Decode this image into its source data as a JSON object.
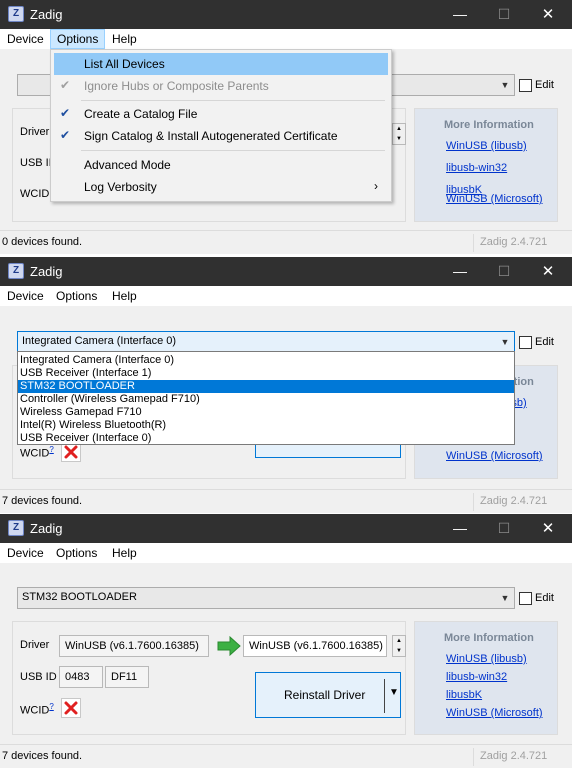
{
  "app": {
    "title": "Zadig",
    "icon": "zadig-app-icon",
    "icon_glyph": "Z",
    "window_buttons": {
      "minimize": "—",
      "maximize": "☐",
      "close": "✕"
    },
    "version": "Zadig 2.4.721"
  },
  "menubar": {
    "device": "Device",
    "options": "Options",
    "help": "Help"
  },
  "labels": {
    "edit": "Edit",
    "driver": "Driver",
    "usb_id": "USB ID",
    "wcid": "WCID",
    "wcid_sup": "?"
  },
  "more_info": {
    "title": "More Information",
    "links": [
      "WinUSB (libusb)",
      "libusb-win32",
      "libusbK",
      "WinUSB (Microsoft)"
    ]
  },
  "options_menu": {
    "items": [
      {
        "label": "List All Devices",
        "checked": false,
        "disabled": false,
        "highlighted": true
      },
      {
        "label": "Ignore Hubs or Composite Parents",
        "checked": true,
        "disabled": true,
        "highlighted": false
      },
      {
        "label": "Create a Catalog File",
        "checked": true,
        "disabled": false,
        "highlighted": false
      },
      {
        "label": "Sign Catalog & Install Autogenerated Certificate",
        "checked": true,
        "disabled": false,
        "highlighted": false
      },
      {
        "label": "Advanced Mode",
        "checked": false,
        "disabled": false,
        "highlighted": false
      },
      {
        "label": "Log Verbosity",
        "checked": false,
        "disabled": false,
        "highlighted": false,
        "submenu": true
      }
    ],
    "check_glyph": "✔",
    "submenu_glyph": "›"
  },
  "window1": {
    "status": "0 devices found.",
    "device_value": ""
  },
  "window2": {
    "status": "7 devices found.",
    "device_value": "Integrated Camera (Interface 0)",
    "device_options": [
      "Integrated Camera (Interface 0)",
      "USB Receiver (Interface 1)",
      "STM32  BOOTLOADER",
      "Controller (Wireless Gamepad F710)",
      "Wireless Gamepad F710",
      "Intel(R) Wireless Bluetooth(R)",
      "USB Receiver (Interface 0)"
    ],
    "selected_option": "STM32  BOOTLOADER"
  },
  "window3": {
    "status": "7 devices found.",
    "device_value": "STM32  BOOTLOADER",
    "current_driver": "WinUSB (v6.1.7600.16385)",
    "target_driver": "WinUSB (v6.1.7600.16385)",
    "usb_vid": "0483",
    "usb_pid": "DF11",
    "reinstall_label": "Reinstall Driver"
  },
  "colors": {
    "accent": "#0078d7",
    "titlebar": "#303030",
    "info_panel": "#dfe5ee",
    "link": "#0033cc",
    "arrow_green": "#3cb043",
    "wcid_red": "#e02020"
  }
}
